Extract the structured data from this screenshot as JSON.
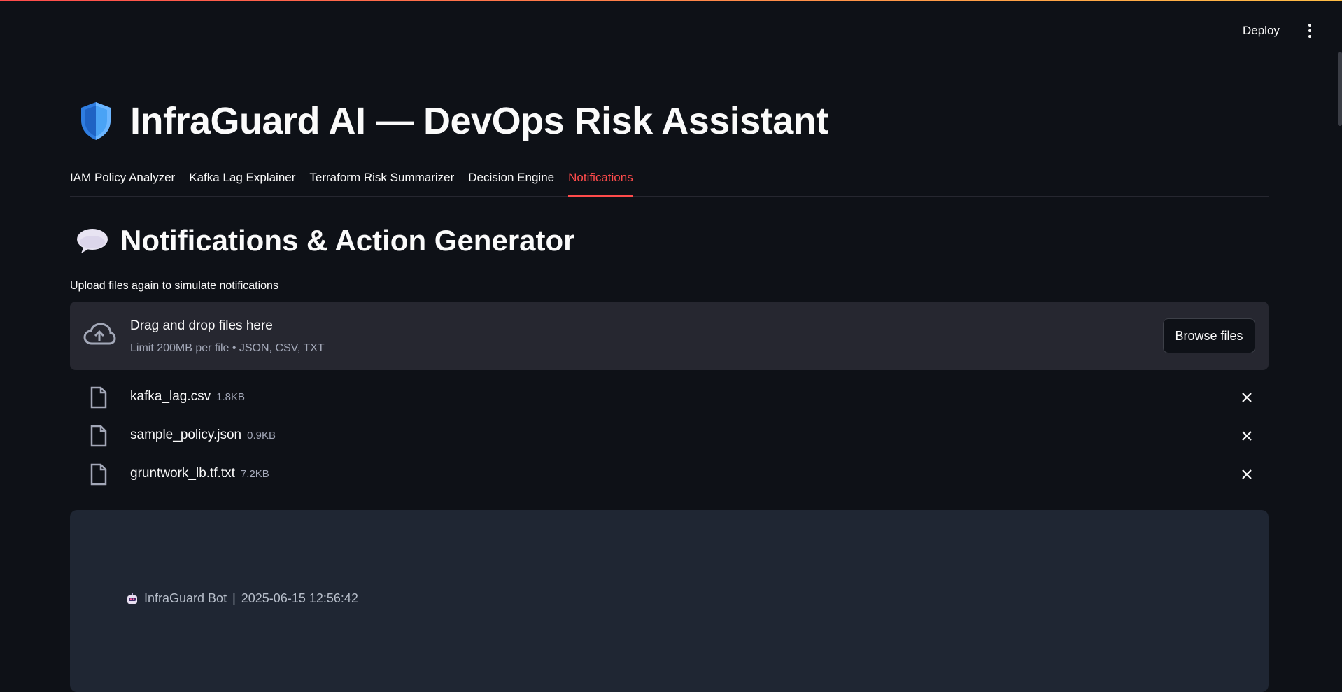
{
  "header": {
    "deploy_label": "Deploy",
    "menu_icon": "vertical-dots-icon"
  },
  "page": {
    "title": "InfraGuard AI — DevOps Risk Assistant",
    "title_icon": "shield-icon"
  },
  "tabs": [
    {
      "label": "IAM Policy Analyzer",
      "active": false
    },
    {
      "label": "Kafka Lag Explainer",
      "active": false
    },
    {
      "label": "Terraform Risk Summarizer",
      "active": false
    },
    {
      "label": "Decision Engine",
      "active": false
    },
    {
      "label": "Notifications",
      "active": true
    }
  ],
  "section": {
    "title": "Notifications & Action Generator",
    "icon": "speech-balloon-icon"
  },
  "uploader": {
    "label": "Upload files again to simulate notifications",
    "drop_title": "Drag and drop files here",
    "limit_text": "Limit 200MB per file • JSON, CSV, TXT",
    "browse_label": "Browse files",
    "files": [
      {
        "name": "kafka_lag.csv",
        "size": "1.8KB"
      },
      {
        "name": "sample_policy.json",
        "size": "0.9KB"
      },
      {
        "name": "gruntwork_lb.tf.txt",
        "size": "7.2KB"
      }
    ]
  },
  "notification": {
    "bot_name": "InfraGuard Bot",
    "separator": "|",
    "timestamp": "2025-06-15 12:56:42"
  },
  "colors": {
    "background": "#0e1117",
    "accent": "#ff4b4b",
    "dropzone": "#262730",
    "card": "#1f2633"
  }
}
